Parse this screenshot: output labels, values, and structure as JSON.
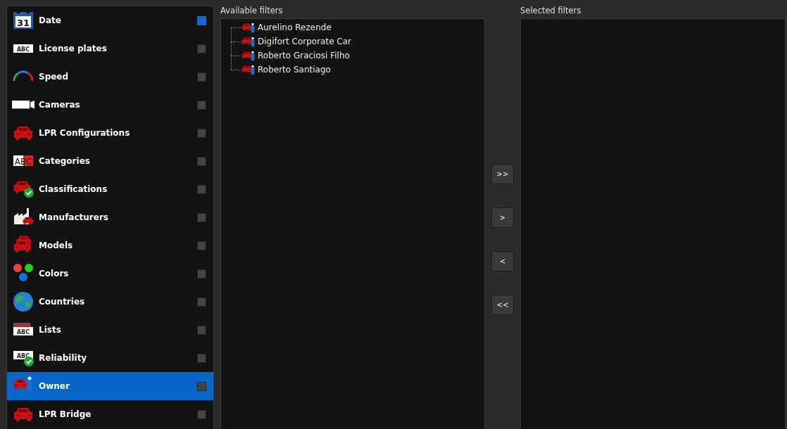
{
  "categories": [
    {
      "label": "Date",
      "icon_text": "31",
      "checked": true,
      "selected": false
    },
    {
      "label": "License plates",
      "icon_text": "ABC",
      "checked": false,
      "selected": false
    },
    {
      "label": "Speed",
      "checked": false,
      "selected": false
    },
    {
      "label": "Cameras",
      "checked": false,
      "selected": false
    },
    {
      "label": "LPR Configurations",
      "checked": false,
      "selected": false
    },
    {
      "label": "Categories",
      "icon_text": "ABC",
      "checked": false,
      "selected": false
    },
    {
      "label": "Classifications",
      "checked": false,
      "selected": false
    },
    {
      "label": "Manufacturers",
      "checked": false,
      "selected": false
    },
    {
      "label": "Models",
      "checked": false,
      "selected": false
    },
    {
      "label": "Colors",
      "checked": false,
      "selected": false
    },
    {
      "label": "Countries",
      "checked": false,
      "selected": false
    },
    {
      "label": "Lists",
      "icon_text": "ABC",
      "checked": false,
      "selected": false
    },
    {
      "label": "Reliability",
      "icon_text": "ABC",
      "checked": false,
      "selected": false
    },
    {
      "label": "Owner",
      "checked": false,
      "selected": true
    },
    {
      "label": "LPR Bridge",
      "checked": false,
      "selected": false
    }
  ],
  "available_filters": {
    "title": "Available filters",
    "items": [
      {
        "label": "Aurelino Rezende"
      },
      {
        "label": "Digifort Corporate Car"
      },
      {
        "label": "Roberto Graciosi Filho"
      },
      {
        "label": "Roberto Santiago"
      }
    ]
  },
  "transfer_buttons": [
    ">>",
    ">",
    "<",
    "<<"
  ],
  "selected_filters": {
    "title": "Selected filters"
  }
}
